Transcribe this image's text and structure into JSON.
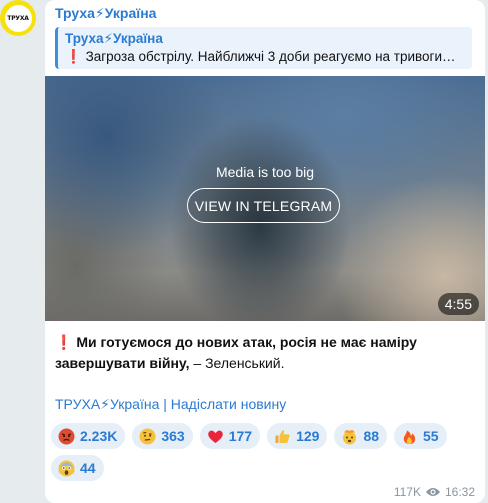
{
  "channel": {
    "avatar_text": "ТРУХА",
    "name": "Труха⚡Україна"
  },
  "reply": {
    "title": "Труха⚡Україна",
    "mark": "❗",
    "text": "Загроза обстрілу. Найближчі 3 доби реагуємо на тривоги…"
  },
  "media": {
    "label": "Media is too big",
    "button": "VIEW IN TELEGRAM",
    "duration": "4:55"
  },
  "post": {
    "mark": "❗",
    "bold_text": "Ми готуємося до нових атак, росія не має наміру завершувати війну,",
    "plain_text": " – Зеленський.",
    "footer_link": "ТРУХА⚡Україна | Надіслати новину"
  },
  "reactions": [
    {
      "icon": "angry-face-icon",
      "count": "2.23K"
    },
    {
      "icon": "raised-eyebrow-face-icon",
      "count": "363"
    },
    {
      "icon": "heart-icon",
      "count": "177"
    },
    {
      "icon": "thumbs-up-icon",
      "count": "129"
    },
    {
      "icon": "exploding-head-icon",
      "count": "88"
    },
    {
      "icon": "fire-icon",
      "count": "55"
    },
    {
      "icon": "screaming-face-icon",
      "count": "44"
    }
  ],
  "meta": {
    "views": "117K",
    "time": "16:32"
  },
  "colors": {
    "accent": "#2a7bd1",
    "bubble": "#ffffff",
    "background": "#e6ebee",
    "reaction_bg": "#e6eef8"
  }
}
